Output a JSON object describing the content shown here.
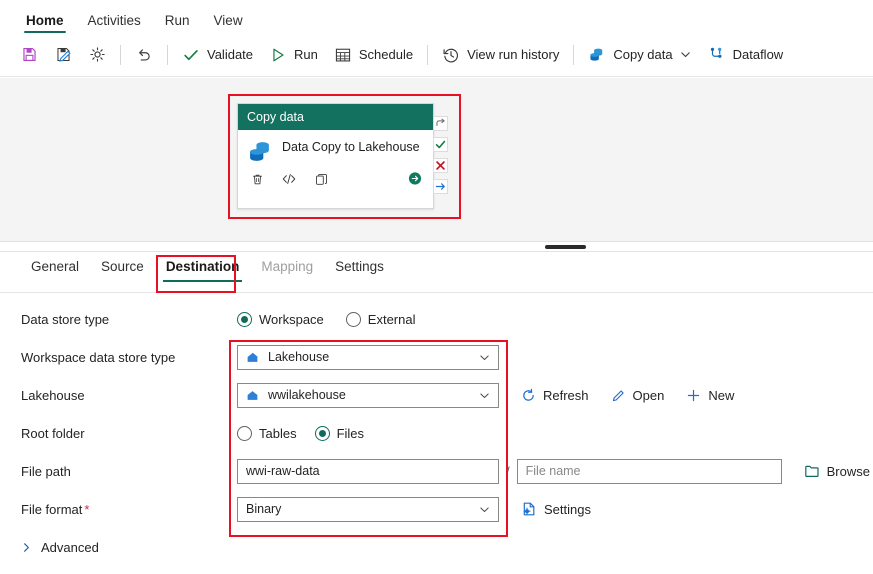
{
  "ribbon": {
    "tabs": [
      {
        "label": "Home",
        "active": true
      },
      {
        "label": "Activities",
        "active": false
      },
      {
        "label": "Run",
        "active": false
      },
      {
        "label": "View",
        "active": false
      }
    ]
  },
  "commandbar": {
    "items": [
      {
        "label": "",
        "icon": "save-icon"
      },
      {
        "label": "",
        "icon": "save-as-icon"
      },
      {
        "label": "",
        "icon": "settings-gear-icon"
      },
      {
        "label": "",
        "icon": "undo-icon"
      },
      {
        "label": "Validate",
        "icon": "checkmark-icon"
      },
      {
        "label": "Run",
        "icon": "play-icon"
      },
      {
        "label": "Schedule",
        "icon": "calendar-icon"
      },
      {
        "label": "View run history",
        "icon": "history-icon"
      },
      {
        "label": "Copy data",
        "icon": "copy-data-icon",
        "chevron": true
      },
      {
        "label": "Dataflow",
        "icon": "dataflow-icon"
      }
    ]
  },
  "canvas": {
    "activity": {
      "header": "Copy data",
      "title": "Data Copy to Lakehouse",
      "actions": [
        "delete-icon",
        "code-view-icon",
        "duplicate-icon",
        "run-arrow-icon"
      ],
      "connectors": [
        "on-skip-icon",
        "on-success-icon",
        "on-failure-icon",
        "on-completion-icon"
      ]
    }
  },
  "panel": {
    "tabs": [
      {
        "label": "General",
        "state": "normal"
      },
      {
        "label": "Source",
        "state": "normal"
      },
      {
        "label": "Destination",
        "state": "active"
      },
      {
        "label": "Mapping",
        "state": "disabled"
      },
      {
        "label": "Settings",
        "state": "normal"
      }
    ],
    "fields": {
      "data_store_type": {
        "label": "Data store type",
        "options": [
          {
            "label": "Workspace",
            "selected": true
          },
          {
            "label": "External",
            "selected": false
          }
        ]
      },
      "workspace_data_store_type": {
        "label": "Workspace data store type",
        "value": "Lakehouse",
        "icon": "lakehouse-icon"
      },
      "lakehouse": {
        "label": "Lakehouse",
        "value": "wwilakehouse",
        "icon": "lakehouse-icon",
        "buttons": [
          {
            "label": "Refresh",
            "icon": "refresh-icon"
          },
          {
            "label": "Open",
            "icon": "pencil-icon"
          },
          {
            "label": "New",
            "icon": "plus-icon"
          }
        ]
      },
      "root_folder": {
        "label": "Root folder",
        "options": [
          {
            "label": "Tables",
            "selected": false
          },
          {
            "label": "Files",
            "selected": true
          }
        ]
      },
      "file_path": {
        "label": "File path",
        "value": "wwi-raw-data",
        "separator": "/",
        "file_name_placeholder": "File name",
        "file_name_value": "",
        "browse": {
          "label": "Browse",
          "icon": "folder-icon"
        }
      },
      "file_format": {
        "label": "File format",
        "required": "*",
        "value": "Binary",
        "settings": {
          "label": "Settings",
          "icon": "format-settings-icon"
        }
      }
    },
    "advanced": {
      "label": "Advanced",
      "icon": "chevron-right-icon"
    }
  },
  "colors": {
    "accent_green": "#0f6c5c",
    "card_header": "#13715f",
    "highlight_red": "#e81123",
    "icon_blue": "#1f7fd4",
    "save_purple": "#b146c2"
  }
}
